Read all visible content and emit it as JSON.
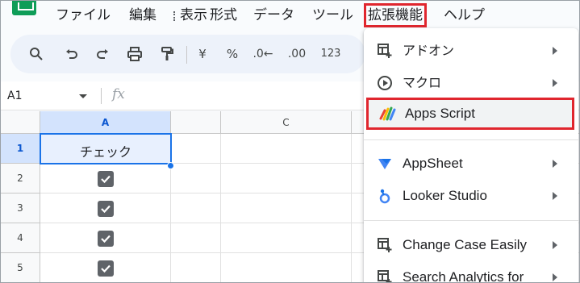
{
  "menubar": {
    "items": [
      {
        "label": "ファイル"
      },
      {
        "label": "編集"
      },
      {
        "label": "表示"
      },
      {
        "label": "形式"
      },
      {
        "label": "データ"
      },
      {
        "label": "ツール"
      },
      {
        "label": "拡張機能",
        "active": true
      },
      {
        "label": "ヘルプ"
      }
    ]
  },
  "toolbar": {
    "currency_label": "¥",
    "percent_label": "%",
    "decrease_decimal_label": ".0←",
    "increase_decimal_label": ".00",
    "number_format_label": "123"
  },
  "formula_bar": {
    "cell_ref": "A1",
    "fx_label": "fx"
  },
  "grid": {
    "columns": [
      "A",
      "C"
    ],
    "rows": [
      "1",
      "2",
      "3",
      "4",
      "5"
    ],
    "cell_a1": "チェック",
    "checked_rows": [
      "2",
      "3",
      "4",
      "5"
    ]
  },
  "extensions_menu": {
    "items": [
      {
        "label": "アドオン",
        "icon": "addon-icon",
        "submenu": true
      },
      {
        "label": "マクロ",
        "icon": "macro-play-icon",
        "submenu": true
      },
      {
        "label": "Apps Script",
        "icon": "apps-script-icon",
        "submenu": false,
        "highlighted": true
      },
      {
        "label": "AppSheet",
        "icon": "appsheet-icon",
        "submenu": true
      },
      {
        "label": "Looker Studio",
        "icon": "looker-studio-icon",
        "submenu": true
      },
      {
        "label": "Change Case Easily",
        "icon": "addon-icon",
        "submenu": true
      },
      {
        "label": "Search Analytics for",
        "icon": "addon-icon",
        "submenu": true
      }
    ]
  },
  "colors": {
    "highlight_border": "#e0262e",
    "selection_blue": "#1a73e8",
    "sheets_green": "#0f9d58"
  }
}
